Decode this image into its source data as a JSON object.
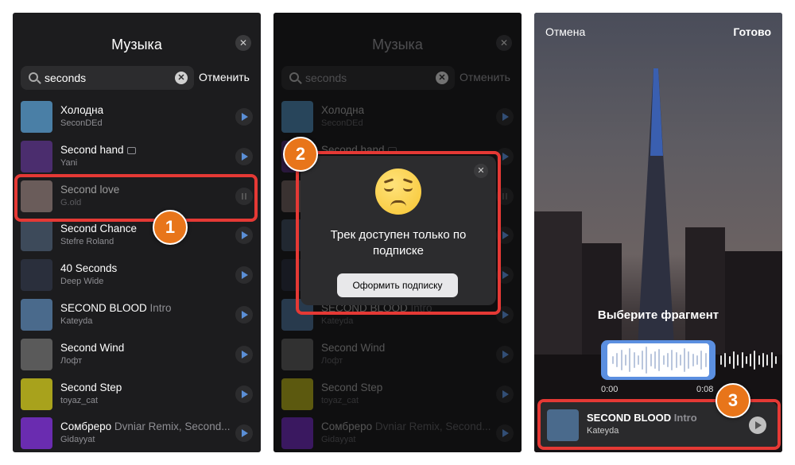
{
  "screens": [
    {
      "title": "Музыка",
      "search": {
        "value": "seconds",
        "cancel": "Отменить"
      },
      "tracks": [
        {
          "name": "Холодна",
          "suffix": "",
          "artist": "SeconDEd",
          "cover": "#4a7fa6",
          "badge": false
        },
        {
          "name": "Second hand",
          "suffix": "",
          "artist": "Yani",
          "cover": "#4b2d6e",
          "badge": true
        },
        {
          "name": "Second love",
          "suffix": "",
          "artist": "G.old",
          "cover": "#6a5c5a",
          "badge": false
        },
        {
          "name": "Second Chance",
          "suffix": "",
          "artist": "Stefre Roland",
          "cover": "#3d4a5a",
          "badge": false
        },
        {
          "name": "40 Seconds",
          "suffix": "",
          "artist": "Deep Wide",
          "cover": "#2a2f3c",
          "badge": false
        },
        {
          "name": "SECOND BLOOD",
          "suffix": " Intro",
          "artist": "Kateyda",
          "cover": "#4a6a8c",
          "badge": false
        },
        {
          "name": "Second Wind",
          "suffix": "",
          "artist": "Лофт",
          "cover": "#5a5a5a",
          "badge": false
        },
        {
          "name": "Second Step",
          "suffix": "",
          "artist": "toyaz_cat",
          "cover": "#a8a21c",
          "badge": false
        },
        {
          "name": "Сомбреро",
          "suffix": " Dvniar Remix, Second...",
          "artist": "Gidayyat",
          "cover": "#6a2cb0",
          "badge": false
        }
      ]
    }
  ],
  "markers": {
    "one": "1",
    "two": "2",
    "three": "3"
  },
  "popup": {
    "message": "Трек доступен только по подписке",
    "button": "Оформить подписку"
  },
  "editor": {
    "cancel": "Отмена",
    "done": "Готово",
    "pick_label": "Выберите фрагмент",
    "time_start": "0:00",
    "time_end": "0:08",
    "track": {
      "name": "SECOND BLOOD",
      "suffix": " Intro",
      "artist": "Kateyda"
    }
  },
  "colors": {
    "accent": "#5b8fd6",
    "marker": "#e8751a",
    "frame": "#e53935"
  }
}
